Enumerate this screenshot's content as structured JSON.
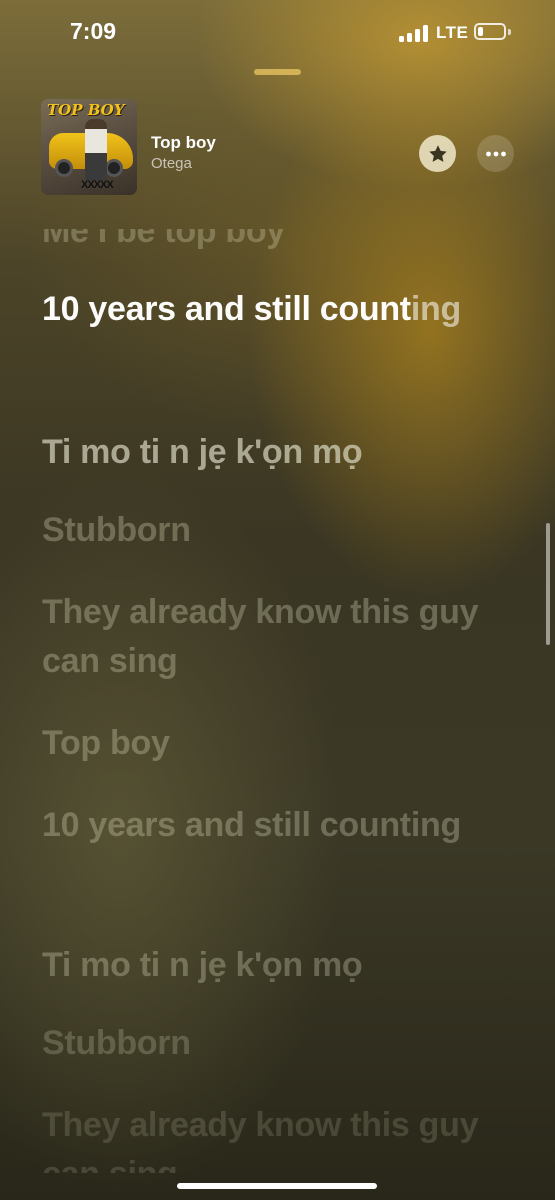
{
  "status_bar": {
    "time": "7:09",
    "network": "LTE",
    "battery_level": 0.2,
    "signal_bars": 4
  },
  "now_playing": {
    "title": "Top boy",
    "artist": "Otega",
    "artwork_text": "TOP BOY",
    "artwork_tag": "XXXXX"
  },
  "controls": {
    "favorite_icon": "star-icon",
    "more_icon": "ellipsis-icon"
  },
  "lyrics": {
    "previous": "Me I be top boy",
    "current_part1": "10 years and still count",
    "current_part2": "ing",
    "line2": "Ti mo ti n jẹ k'ọn mọ",
    "line3": "Stubborn",
    "line4": "They already know this guy can sing",
    "line5": "Top boy",
    "line6": "10 years and still counting",
    "line7": "Ti mo ti n jẹ k'ọn mọ",
    "line8": "Stubborn",
    "line9": "They already know this guy can sing"
  },
  "colors": {
    "accent": "#d7b45a",
    "background": "#3a3623"
  }
}
